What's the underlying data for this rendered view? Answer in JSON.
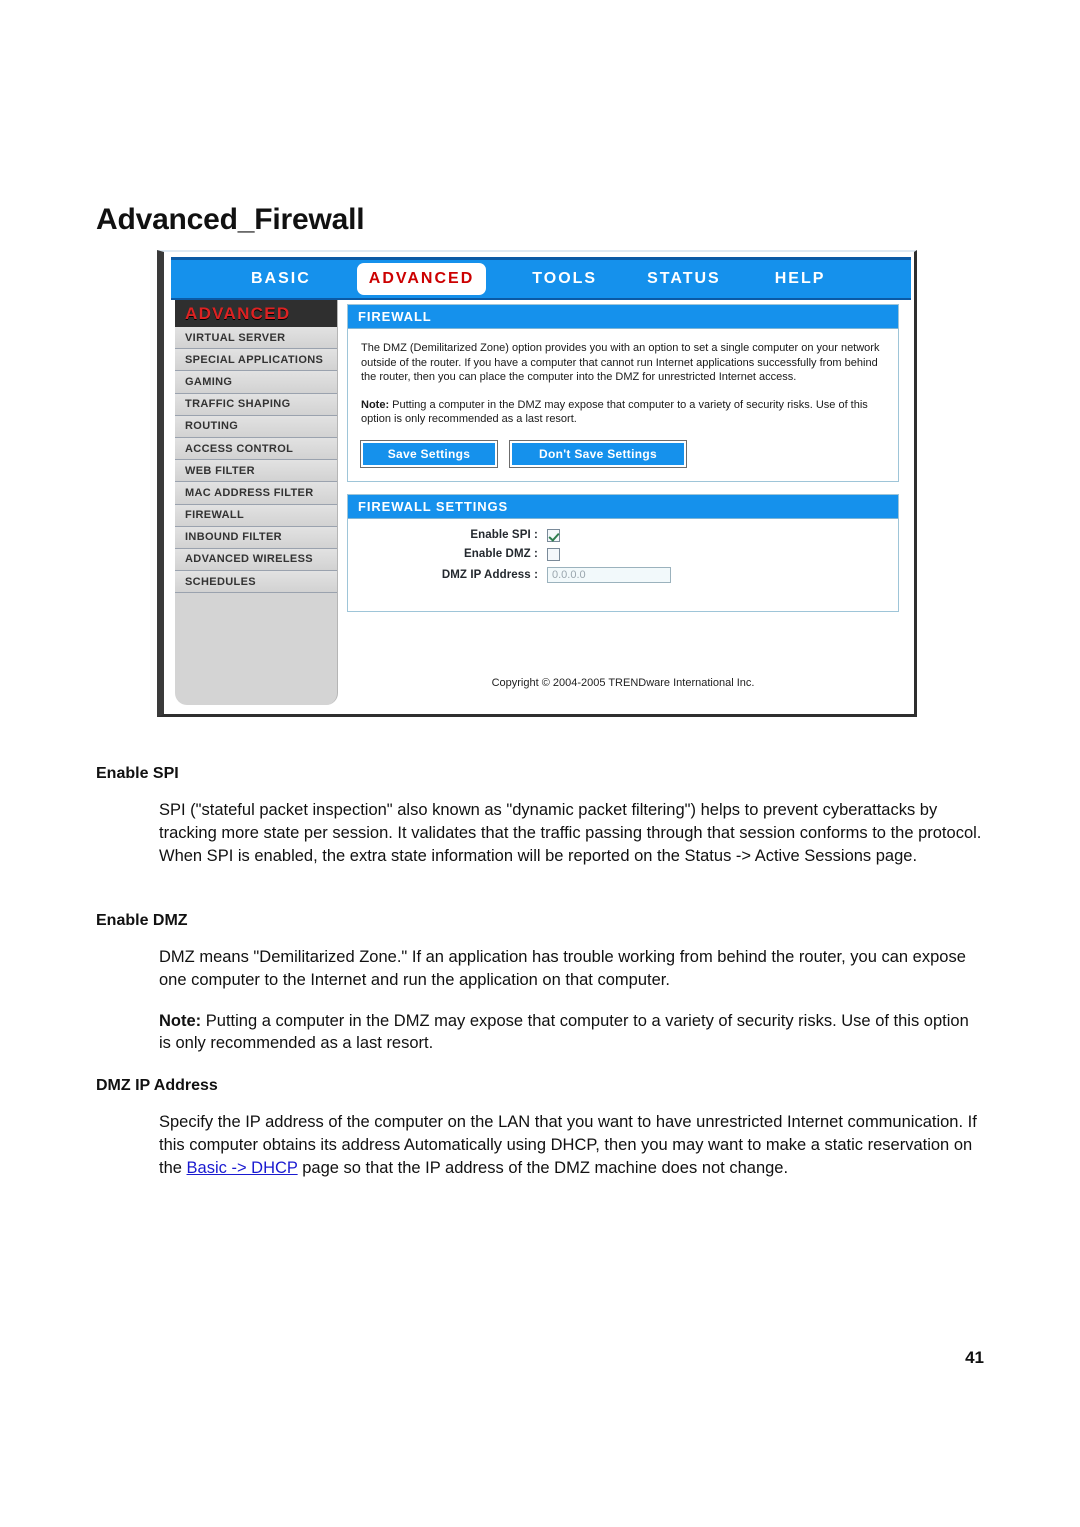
{
  "document": {
    "title": "Advanced_Firewall",
    "page_number": "41"
  },
  "router_ui": {
    "nav": {
      "basic": "BASIC",
      "advanced": "ADVANCED",
      "tools": "TOOLS",
      "status": "STATUS",
      "help": "HELP"
    },
    "sidebar": {
      "title": "ADVANCED",
      "items": [
        {
          "label": "VIRTUAL SERVER"
        },
        {
          "label": "SPECIAL APPLICATIONS"
        },
        {
          "label": "GAMING"
        },
        {
          "label": "TRAFFIC SHAPING"
        },
        {
          "label": "ROUTING"
        },
        {
          "label": "ACCESS CONTROL"
        },
        {
          "label": "WEB FILTER"
        },
        {
          "label": "MAC ADDRESS FILTER"
        },
        {
          "label": "FIREWALL"
        },
        {
          "label": "INBOUND FILTER"
        },
        {
          "label": "ADVANCED WIRELESS"
        },
        {
          "label": "SCHEDULES"
        }
      ]
    },
    "firewall_panel": {
      "heading": "FIREWALL",
      "description": "The DMZ (Demilitarized Zone) option provides you with an option to set a single computer on your network outside of the router. If you have a computer that cannot run Internet applications successfully from behind the router, then you can place the computer into the DMZ for unrestricted Internet access.",
      "note_label": "Note:",
      "note_text": " Putting a computer in the DMZ may expose that computer to a variety of security risks. Use of this option is only recommended as a last resort.",
      "save_button": "Save Settings",
      "dont_save_button": "Don't Save Settings"
    },
    "firewall_settings": {
      "heading": "FIREWALL SETTINGS",
      "enable_spi_label": "Enable SPI :",
      "enable_spi_checked": true,
      "enable_dmz_label": "Enable DMZ :",
      "enable_dmz_checked": false,
      "dmz_ip_label": "DMZ IP Address :",
      "dmz_ip_value": "0.0.0.0"
    },
    "copyright": "Copyright © 2004-2005 TRENDware International Inc."
  },
  "sections": {
    "spi": {
      "heading": "Enable SPI",
      "body": "SPI (\"stateful packet inspection\" also known as \"dynamic packet filtering\") helps to prevent cyberattacks by tracking more state per session. It validates that the traffic passing through that session conforms to the protocol. When SPI is enabled, the extra state information will be reported on the Status -> Active Sessions page."
    },
    "dmz": {
      "heading": "Enable DMZ",
      "body": "DMZ means \"Demilitarized Zone.\" If an application has trouble working from behind the router, you can expose one computer to the Internet and run the application on that computer.",
      "note_label": "Note:",
      "note_text": " Putting a computer in the DMZ may expose that computer to a variety of security risks. Use of this option is only recommended as a last resort."
    },
    "ip": {
      "heading": "DMZ IP Address",
      "body_part1": "Specify the IP address of the computer on the LAN that you want to have unrestricted Internet communication. If this computer obtains its address Automatically using DHCP, then you may want to make a static reservation on the ",
      "link_text": "Basic -> DHCP",
      "body_part2": " page so that the IP address of the DMZ machine does not change."
    }
  },
  "colors": {
    "nav_blue": "#1591ec",
    "accent_red": "#cc0000",
    "link_blue": "#1a1ad0",
    "sidebar_gray": "#d4d4d4",
    "check_green": "#2e7d4f"
  }
}
